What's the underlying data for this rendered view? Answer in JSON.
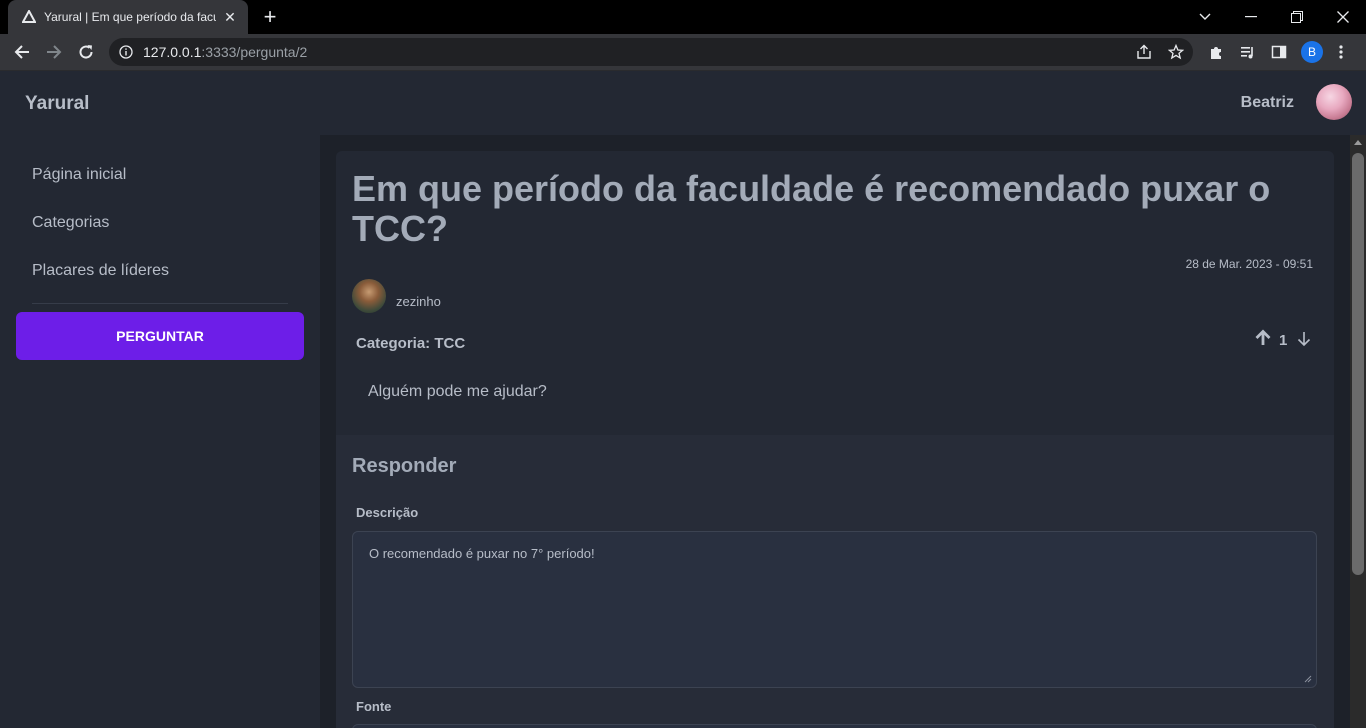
{
  "browser": {
    "tab_title": "Yarural | Em que período da facul",
    "url_host": "127.0.0.1",
    "url_path": ":3333/pergunta/2",
    "profile_initial": "B"
  },
  "app": {
    "brand": "Yarural",
    "user_name": "Beatriz"
  },
  "sidebar": {
    "items": [
      {
        "label": "Página inicial"
      },
      {
        "label": "Categorias"
      },
      {
        "label": "Placares de líderes"
      }
    ],
    "ask_button": "PERGUNTAR"
  },
  "question": {
    "title": "Em que período da faculdade é recomendado puxar o TCC?",
    "date": "28 de Mar. 2023 - 09:51",
    "author": "zezinho",
    "category": "Categoria: TCC",
    "votes": "1",
    "body": "Alguém pode me ajudar?"
  },
  "answer_form": {
    "heading": "Responder",
    "description_label": "Descrição",
    "description_value": "O recomendado é puxar no 7° período!",
    "source_label": "Fonte"
  },
  "colors": {
    "accent": "#6d1ee8",
    "background": "#1d2129",
    "panel": "#232833"
  }
}
